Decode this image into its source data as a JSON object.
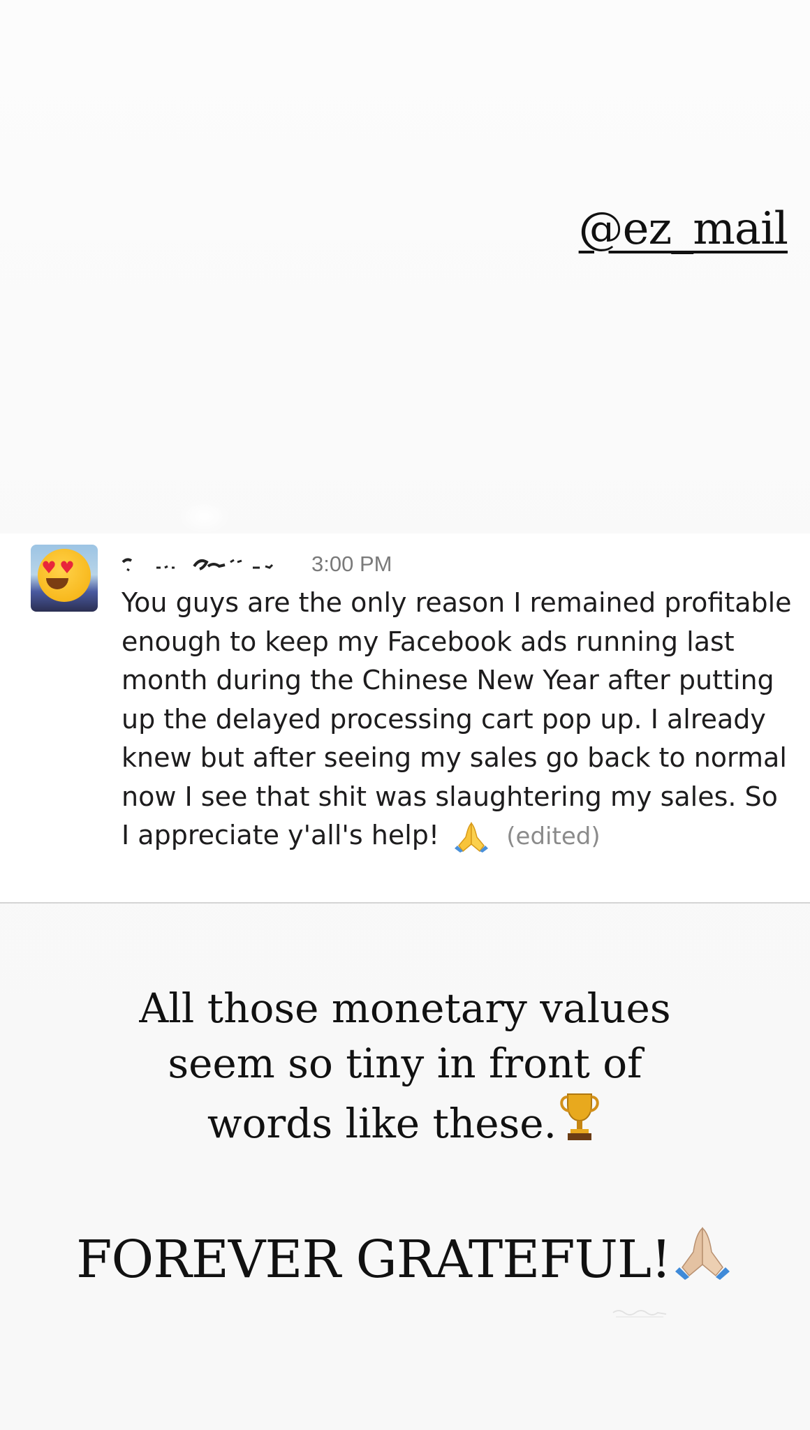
{
  "story": {
    "handle": "@ez_mail",
    "background_color": "#f9f9f9"
  },
  "message": {
    "author_name": "",
    "timestamp": "3:00 PM",
    "body": "You guys are the only reason I remained profitable enough to keep my Facebook ads running last month during the Chinese New Year after putting up the delayed processing cart pop up. I already knew but after seeing my sales go back to normal now I see that shit was slaughtering my sales. So I appreciate y'all's help!",
    "reaction_icon": "folded-hands-icon",
    "edited_label": "(edited)",
    "avatar_icon": "heart-eyes-emoji-icon"
  },
  "captions": {
    "line1": "All those monetary values seem so tiny in front of words like these.",
    "line1_icon": "trophy-icon",
    "line2": "FOREVER GRATEFUL!",
    "line2_icon": "folded-hands-icon"
  },
  "colors": {
    "text_primary": "#1d1c1d",
    "text_secondary": "#7a7a7a",
    "divider": "#d4d4d4",
    "trophy_gold": "#e0a21c"
  }
}
